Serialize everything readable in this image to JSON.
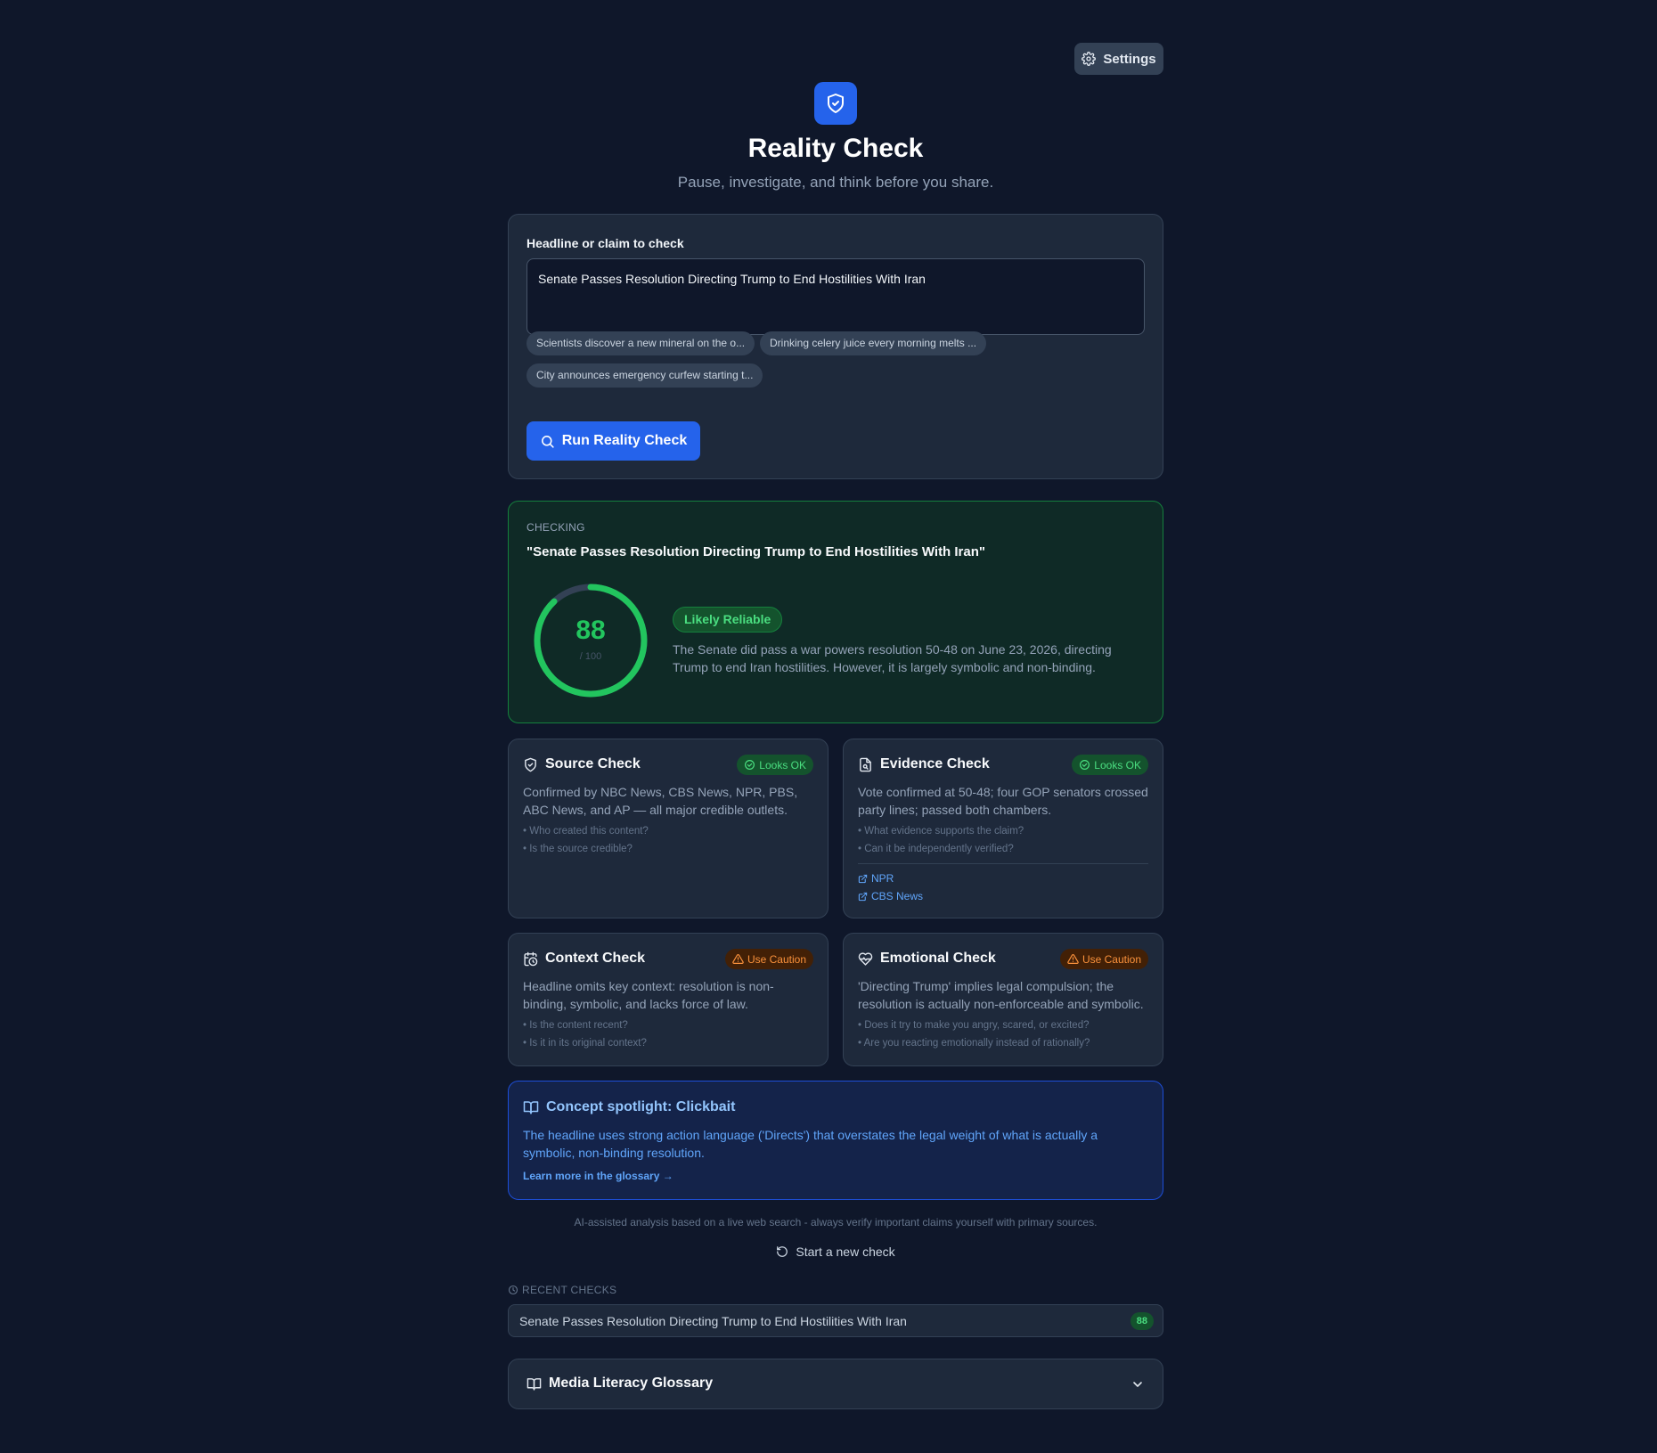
{
  "header": {
    "settings_label": "Settings",
    "title": "Reality Check",
    "subtitle": "Pause, investigate, and think before you share."
  },
  "form": {
    "label": "Headline or claim to check",
    "value": "Senate Passes Resolution Directing Trump to End Hostilities With Iran",
    "examples": [
      "Scientists discover a new mineral on the o...",
      "Drinking celery juice every morning melts ...",
      "City announces emergency curfew starting t..."
    ],
    "run_label": "Run Reality Check"
  },
  "result": {
    "checking_label": "CHECKING",
    "claim": "\"Senate Passes Resolution Directing Trump to End Hostilities With Iran\"",
    "score": 88,
    "score_text": "88",
    "score_max": "/ 100",
    "verdict": "Likely Reliable",
    "summary": "The Senate did pass a war powers resolution 50-48 on June 23, 2026, directing Trump to end Iran hostilities. However, it is largely symbolic and non-binding.",
    "accent_color": "#22c55e"
  },
  "checks": [
    {
      "title": "Source Check",
      "icon": "shield-icon",
      "status": "Looks OK",
      "body": "Confirmed by NBC News, CBS News, NPR, PBS, ABC News, and AP — all major credible outlets.",
      "questions": [
        "• Who created this content?",
        "• Is the source credible?"
      ]
    },
    {
      "title": "Evidence Check",
      "icon": "file-search-icon",
      "status": "Looks OK",
      "body": "Vote confirmed at 50-48; four GOP senators crossed party lines; passed both chambers.",
      "questions": [
        "• What evidence supports the claim?",
        "• Can it be independently verified?"
      ],
      "links": [
        "NPR",
        "CBS News"
      ]
    },
    {
      "title": "Context Check",
      "icon": "calendar-clock-icon",
      "status": "Use Caution",
      "body": "Headline omits key context: resolution is non-binding, symbolic, and lacks force of law.",
      "questions": [
        "• Is the content recent?",
        "• Is it in its original context?"
      ]
    },
    {
      "title": "Emotional Check",
      "icon": "heart-pulse-icon",
      "status": "Use Caution",
      "body": "'Directing Trump' implies legal compulsion; the resolution is actually non-enforceable and symbolic.",
      "questions": [
        "• Does it try to make you angry, scared, or excited?",
        "• Are you reacting emotionally instead of rationally?"
      ]
    }
  ],
  "concept": {
    "title": "Concept spotlight: Clickbait",
    "text": "The headline uses strong action language ('Directs') that overstates the legal weight of what is actually a symbolic, non-binding resolution.",
    "link": "Learn more in the glossary →"
  },
  "footer": {
    "disclaimer": "AI-assisted analysis based on a live web search - always verify important claims yourself with primary sources.",
    "new_check": "Start a new check",
    "recent_label": "RECENT CHECKS",
    "recent": [
      {
        "text": "Senate Passes Resolution Directing Trump to End Hostilities With Iran",
        "score": "88"
      }
    ],
    "glossary_title": "Media Literacy Glossary"
  }
}
